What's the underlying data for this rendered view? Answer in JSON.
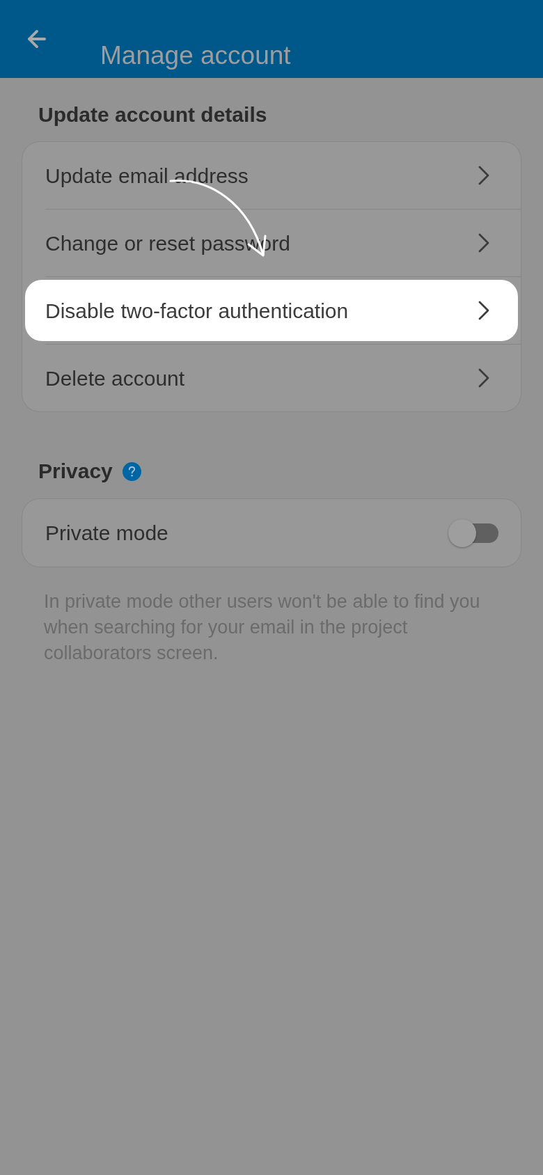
{
  "app_bar": {
    "title": "Manage account"
  },
  "account_section": {
    "heading": "Update account details",
    "items": [
      {
        "label": "Update email address",
        "highlighted": false
      },
      {
        "label": "Change or reset password",
        "highlighted": false
      },
      {
        "label": "Disable two-factor authentication",
        "highlighted": true
      },
      {
        "label": "Delete account",
        "highlighted": false
      }
    ]
  },
  "privacy_section": {
    "heading": "Privacy",
    "settings": [
      {
        "label": "Private mode",
        "on": false
      }
    ],
    "note": "In private mode other users won't be able to find you when searching for your email in the project collaborators screen."
  }
}
